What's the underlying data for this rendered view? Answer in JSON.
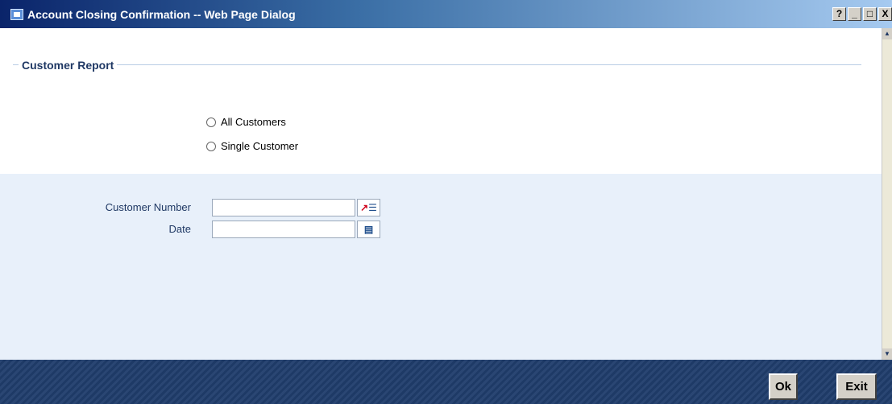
{
  "window": {
    "title": "Account Closing Confirmation -- Web Page Dialog",
    "help_label": "?",
    "minimize_label": "_",
    "maximize_label": "□",
    "close_label": "X"
  },
  "section": {
    "legend": "Customer Report"
  },
  "report_options": [
    {
      "label": "All Customers",
      "selected": false
    },
    {
      "label": "Single Customer",
      "selected": false
    }
  ],
  "fields": {
    "customer_number": {
      "label": "Customer Number",
      "value": "",
      "icon": "list-of-values-icon"
    },
    "date": {
      "label": "Date",
      "value": "",
      "icon": "calendar-icon"
    }
  },
  "footer": {
    "ok_label": "Ok",
    "exit_label": "Exit"
  },
  "colors": {
    "title_bar": "#0a246a",
    "footer": "#2a4673",
    "panel": "#e8f0fa",
    "legend_text": "#1f3864"
  }
}
